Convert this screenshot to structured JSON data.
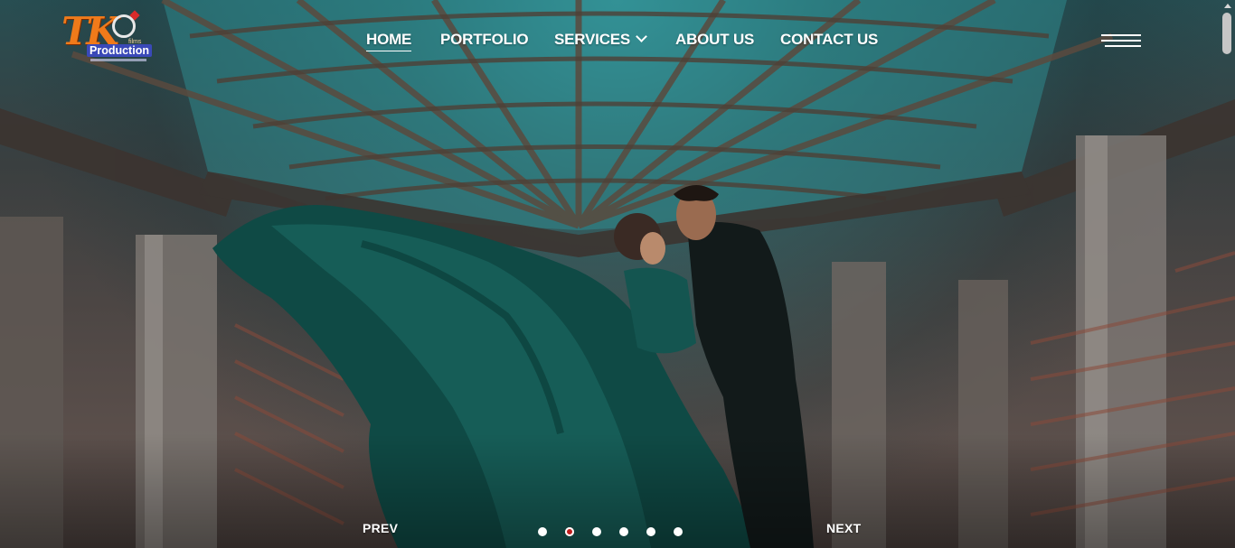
{
  "brand": {
    "logo_mark": "TK",
    "logo_name": "Production",
    "logo_small": "films"
  },
  "nav": {
    "items": [
      {
        "label": "HOME",
        "active": true
      },
      {
        "label": "PORTFOLIO",
        "active": false
      },
      {
        "label": "SERVICES",
        "active": false,
        "has_dropdown": true
      },
      {
        "label": "ABOUT US",
        "active": false
      },
      {
        "label": "CONTACT US",
        "active": false
      }
    ],
    "menu_icon": "hamburger-menu-icon"
  },
  "slider": {
    "prev_label": "PREV",
    "next_label": "NEXT",
    "slide_count": 6,
    "active_slide": 2
  },
  "colors": {
    "nav_text": "#ffffff",
    "active_dot_ring": "#c01c1c",
    "logo_orange": "#f07a1a",
    "logo_blue": "#3a49b8"
  }
}
